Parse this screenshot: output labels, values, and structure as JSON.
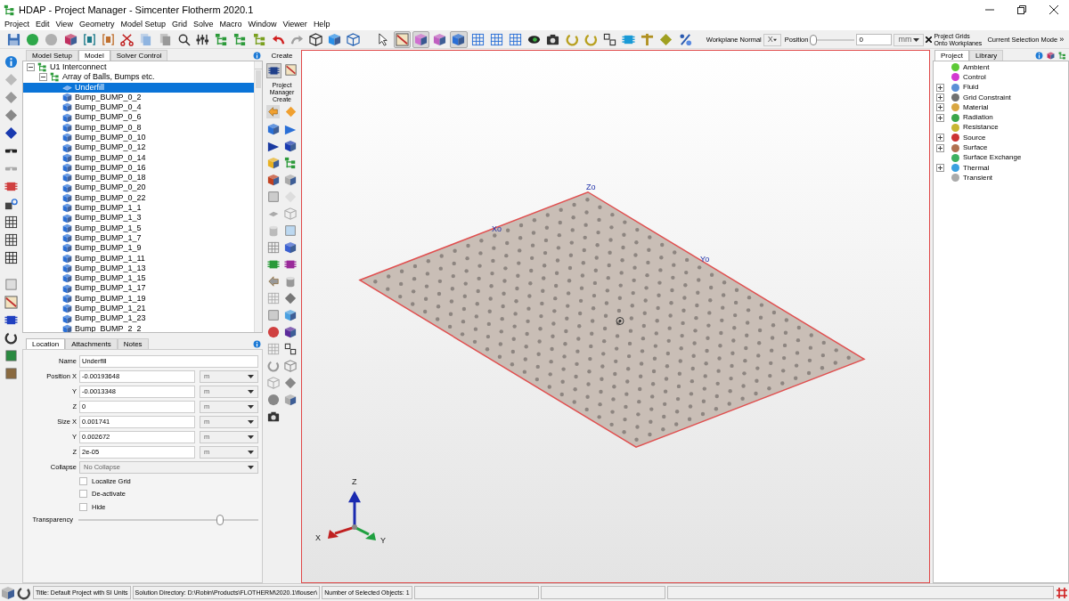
{
  "window": {
    "title": "HDAP - Project Manager - Simcenter Flotherm 2020.1"
  },
  "menu": [
    "Project",
    "Edit",
    "View",
    "Geometry",
    "Model Setup",
    "Grid",
    "Solve",
    "Macro",
    "Window",
    "Viewer",
    "Help"
  ],
  "toolbar": {
    "buttons": [
      {
        "pressed": false
      },
      {
        "pressed": false
      },
      {
        "pressed": false
      },
      {
        "pressed": false
      },
      {
        "pressed": false
      },
      {
        "pressed": false
      },
      {
        "pressed": false
      },
      {
        "pressed": false
      },
      {
        "pressed": false
      },
      {
        "pressed": false
      },
      {
        "pressed": false
      },
      {
        "pressed": false
      },
      {
        "pressed": false
      },
      {
        "pressed": false
      },
      {
        "pressed": false
      },
      {
        "pressed": false
      },
      {
        "pressed": false
      },
      {
        "pressed": false
      },
      {
        "pressed": false
      },
      {
        "pressed": false
      },
      {
        "pressed": true
      },
      {
        "pressed": true
      },
      {
        "pressed": false
      },
      {
        "pressed": true
      },
      {
        "pressed": false
      },
      {
        "pressed": false
      },
      {
        "pressed": false
      },
      {
        "pressed": false
      },
      {
        "pressed": false
      },
      {
        "pressed": false
      },
      {
        "pressed": false
      },
      {
        "pressed": false
      },
      {
        "pressed": false
      },
      {
        "pressed": false
      },
      {
        "pressed": false
      },
      {
        "pressed": false
      }
    ],
    "workplane_label": "Workplane Normal",
    "workplane_axis": "X",
    "position_label": "Position",
    "position_slider": {
      "level": 0
    },
    "position_value": "0",
    "position_unit": "mm",
    "project_grids": "Project Grids Onto Workplanes",
    "selection_mode": "Current Selection Mode",
    "overflow": "»"
  },
  "left_tabs": [
    {
      "label": "Model Setup",
      "selected": false
    },
    {
      "label": "Model",
      "selected": true
    },
    {
      "label": "Solver Control",
      "selected": false
    }
  ],
  "tree": [
    {
      "label": "U1 Interconnect",
      "kind": "assembly",
      "selected": false,
      "expanded": true,
      "children": [
        {
          "label": "Array of Balls, Bumps etc.",
          "kind": "assembly",
          "selected": false,
          "expanded": true,
          "children": [
            {
              "label": "Underfill",
              "kind": "plate",
              "selected": true
            },
            {
              "label": "Bump_BUMP_0_2",
              "kind": "cuboid",
              "selected": false
            },
            {
              "label": "Bump_BUMP_0_4",
              "kind": "cuboid",
              "selected": false
            },
            {
              "label": "Bump_BUMP_0_6",
              "kind": "cuboid",
              "selected": false
            },
            {
              "label": "Bump_BUMP_0_8",
              "kind": "cuboid",
              "selected": false
            },
            {
              "label": "Bump_BUMP_0_10",
              "kind": "cuboid",
              "selected": false
            },
            {
              "label": "Bump_BUMP_0_12",
              "kind": "cuboid",
              "selected": false
            },
            {
              "label": "Bump_BUMP_0_14",
              "kind": "cuboid",
              "selected": false
            },
            {
              "label": "Bump_BUMP_0_16",
              "kind": "cuboid",
              "selected": false
            },
            {
              "label": "Bump_BUMP_0_18",
              "kind": "cuboid",
              "selected": false
            },
            {
              "label": "Bump_BUMP_0_20",
              "kind": "cuboid",
              "selected": false
            },
            {
              "label": "Bump_BUMP_0_22",
              "kind": "cuboid",
              "selected": false
            },
            {
              "label": "Bump_BUMP_1_1",
              "kind": "cuboid",
              "selected": false
            },
            {
              "label": "Bump_BUMP_1_3",
              "kind": "cuboid",
              "selected": false
            },
            {
              "label": "Bump_BUMP_1_5",
              "kind": "cuboid",
              "selected": false
            },
            {
              "label": "Bump_BUMP_1_7",
              "kind": "cuboid",
              "selected": false
            },
            {
              "label": "Bump_BUMP_1_9",
              "kind": "cuboid",
              "selected": false
            },
            {
              "label": "Bump_BUMP_1_11",
              "kind": "cuboid",
              "selected": false
            },
            {
              "label": "Bump_BUMP_1_13",
              "kind": "cuboid",
              "selected": false
            },
            {
              "label": "Bump_BUMP_1_15",
              "kind": "cuboid",
              "selected": false
            },
            {
              "label": "Bump_BUMP_1_17",
              "kind": "cuboid",
              "selected": false
            },
            {
              "label": "Bump_BUMP_1_19",
              "kind": "cuboid",
              "selected": false
            },
            {
              "label": "Bump_BUMP_1_21",
              "kind": "cuboid",
              "selected": false
            },
            {
              "label": "Bump_BUMP_1_23",
              "kind": "cuboid",
              "selected": false
            },
            {
              "label": "Bump_BUMP_2_2",
              "kind": "cuboid",
              "selected": false
            }
          ]
        }
      ]
    }
  ],
  "create_panel": {
    "title": "Create",
    "subtitle": "Project Manager Create"
  },
  "property_tabs": [
    {
      "label": "Location",
      "selected": true
    },
    {
      "label": "Attachments",
      "selected": false
    },
    {
      "label": "Notes",
      "selected": false
    }
  ],
  "properties": {
    "name": {
      "label": "Name",
      "value": "Underfill"
    },
    "fields": [
      {
        "label": "Position X",
        "value": "-0.00193648",
        "unit": "m"
      },
      {
        "label": "Y",
        "value": "-0.0013348",
        "unit": "m"
      },
      {
        "label": "Z",
        "value": "0",
        "unit": "m"
      },
      {
        "label": "Size X",
        "value": "0.001741",
        "unit": "m"
      },
      {
        "label": "Y",
        "value": "0.002672",
        "unit": "m"
      },
      {
        "label": "Z",
        "value": "2e-05",
        "unit": "m"
      }
    ],
    "collapse": {
      "label": "Collapse",
      "value": "No Collapse"
    },
    "checkboxes": [
      {
        "label": "Localize Grid",
        "checked": false
      },
      {
        "label": "De-activate",
        "checked": false
      },
      {
        "label": "Hide",
        "checked": false
      }
    ],
    "transparency": {
      "label": "Transparency",
      "level": 0.8
    }
  },
  "viewport": {
    "labels": [
      "Zo",
      "Xo",
      "Yo"
    ],
    "axes": [
      "Z",
      "X",
      "Y"
    ]
  },
  "library_tabs": [
    {
      "label": "Project",
      "selected": true
    },
    {
      "label": "Library",
      "selected": false
    }
  ],
  "library_tree": [
    {
      "label": "Ambient",
      "expandable": false,
      "color": "#5cc936"
    },
    {
      "label": "Control",
      "expandable": false,
      "color": "#d23ad0"
    },
    {
      "label": "Fluid",
      "expandable": true,
      "color": "#5a8fd6"
    },
    {
      "label": "Grid Constraint",
      "expandable": true,
      "color": "#707070"
    },
    {
      "label": "Material",
      "expandable": true,
      "color": "#d9a640"
    },
    {
      "label": "Radiation",
      "expandable": true,
      "color": "#3aa64a"
    },
    {
      "label": "Resistance",
      "expandable": false,
      "color": "#c8b632"
    },
    {
      "label": "Source",
      "expandable": true,
      "color": "#cc3333"
    },
    {
      "label": "Surface",
      "expandable": true,
      "color": "#b07050"
    },
    {
      "label": "Surface Exchange",
      "expandable": false,
      "color": "#3cb060"
    },
    {
      "label": "Thermal",
      "expandable": true,
      "color": "#3aa0e0"
    },
    {
      "label": "Transient",
      "expandable": false,
      "color": "#aaaaaa"
    }
  ],
  "status_bar": [
    "Title: Default Project with SI Units",
    "Solution Directory: D:\\Robin\\Products\\FLOTHERM\\2020.1\\flouser\\",
    "Number of Selected Objects: 1"
  ]
}
